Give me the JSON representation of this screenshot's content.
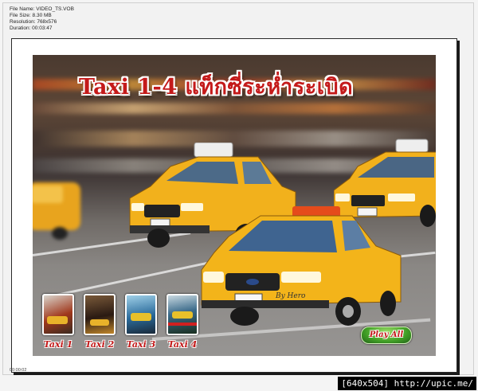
{
  "file_info": {
    "name": "File Name: VIDEO_TS.VOB",
    "size": "File Size: 8.30 MB",
    "resolution": "Resolution: 768x576",
    "duration": "Duration: 00:03:47"
  },
  "menu": {
    "title": "Taxi 1-4  แท็กซี่ระห่ำระเบิด",
    "byline": "By Hero",
    "items": [
      {
        "label": "Taxi 1"
      },
      {
        "label": "Taxi 2"
      },
      {
        "label": "Taxi 3"
      },
      {
        "label": "Taxi 4"
      }
    ],
    "play_all": "Play All"
  },
  "timecode": "00:00:02",
  "footer": "[640x504] http://upic.me/",
  "colors": {
    "title_red": "#c41a1a",
    "taxi_yellow": "#f2b11c",
    "play_green": "#3f9d25"
  }
}
